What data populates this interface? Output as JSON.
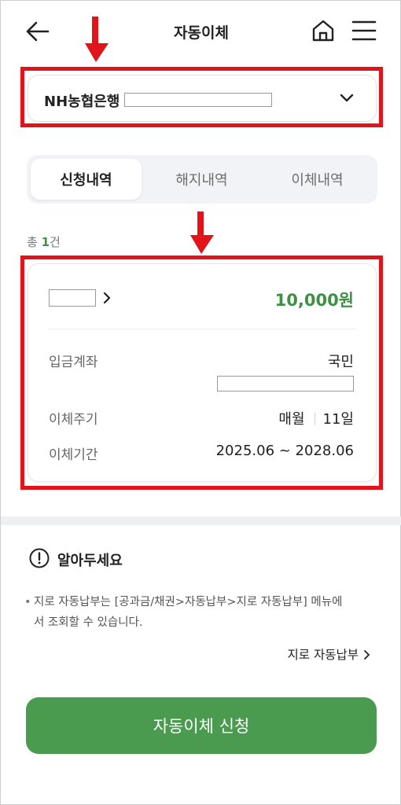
{
  "header": {
    "title": "자동이체"
  },
  "account": {
    "bank_name": "NH농협은행"
  },
  "tabs": [
    {
      "label": "신청내역",
      "active": true
    },
    {
      "label": "해지내역",
      "active": false
    },
    {
      "label": "이체내역",
      "active": false
    }
  ],
  "summary": {
    "prefix": "총 ",
    "count": "1",
    "suffix": "건"
  },
  "transfer_card": {
    "amount": "10,000원",
    "rows": [
      {
        "label": "입금계좌",
        "value": "국민"
      },
      {
        "label": "이체주기",
        "cycle": "매월",
        "day": "11일"
      },
      {
        "label": "이체기간",
        "value": "2025.06 ~ 2028.06"
      }
    ]
  },
  "notice": {
    "title": "알아두세요",
    "text_line1": "지로 자동납부는 [공과금/채권>자동납부>지로 자동납부] 메뉴에",
    "text_line2": "서 조회할 수 있습니다.",
    "link_label": "지로 자동납부"
  },
  "apply_button": {
    "label": "자동이체 신청"
  },
  "colors": {
    "accent_green": "#4a9a4f",
    "amount_green": "#3f8f45",
    "highlight_red": "#e0141a"
  },
  "icons": [
    "back-arrow-icon",
    "home-icon",
    "hamburger-menu-icon",
    "chevron-down-icon",
    "chevron-right-icon",
    "exclamation-circle-icon"
  ]
}
